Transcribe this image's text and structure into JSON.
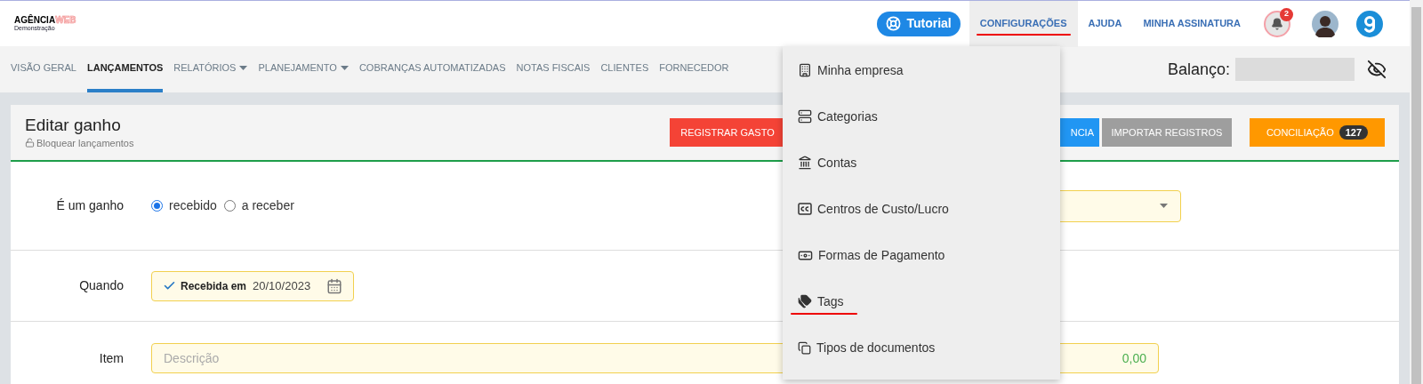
{
  "brand": {
    "name": "AGÊNCIA",
    "accent": "WEB",
    "subtitle": "Demonstração"
  },
  "top_nav": {
    "tutorial": "Tutorial",
    "notifications": "2",
    "links": [
      {
        "label": "CONFIGURAÇÕES",
        "selected": true,
        "highlighted": true
      },
      {
        "label": "AJUDA",
        "selected": false,
        "highlighted": false
      },
      {
        "label": "MINHA ASSINATURA",
        "selected": false,
        "highlighted": false
      }
    ]
  },
  "main_nav": [
    {
      "label": "VISÃO GERAL",
      "selected": false,
      "dropdown": false
    },
    {
      "label": "LANÇAMENTOS",
      "selected": true,
      "dropdown": false
    },
    {
      "label": "RELATÓRIOS",
      "selected": false,
      "dropdown": true
    },
    {
      "label": "PLANEJAMENTO",
      "selected": false,
      "dropdown": true
    },
    {
      "label": "COBRANÇAS AUTOMATIZADAS",
      "selected": false,
      "dropdown": false
    },
    {
      "label": "NOTAS FISCAIS",
      "selected": false,
      "dropdown": false
    },
    {
      "label": "CLIENTES",
      "selected": false,
      "dropdown": false
    },
    {
      "label": "FORNECEDOR",
      "selected": false,
      "dropdown": false
    }
  ],
  "balance": {
    "label": "Balanço:"
  },
  "page": {
    "title": "Editar ganho",
    "lock": "Bloquear lançamentos",
    "buttons": [
      {
        "label": "REGISTRAR GASTO",
        "kind": "danger"
      },
      {
        "label": "NCIA",
        "kind": "info"
      },
      {
        "label": "IMPORTAR REGISTROS",
        "kind": "neutral"
      },
      {
        "label": "CONCILIAÇÃO",
        "kind": "warning",
        "badge": "127"
      }
    ]
  },
  "form": {
    "gain": {
      "label": "É um ganho",
      "options": [
        {
          "label": "recebido",
          "selected": true
        },
        {
          "label": "a receber",
          "selected": false
        }
      ]
    },
    "when": {
      "label": "Quando",
      "status": "Recebida em",
      "date": "20/10/2023"
    },
    "item": {
      "label": "Item",
      "placeholder": "Descrição",
      "amount": "0,00"
    }
  },
  "menu": {
    "items": [
      {
        "label": "Minha empresa",
        "highlighted": false
      },
      {
        "label": "Categorias",
        "highlighted": false
      },
      {
        "label": "Contas",
        "highlighted": false
      },
      {
        "label": "Centros de Custo/Lucro",
        "highlighted": false
      },
      {
        "label": "Formas de Pagamento",
        "highlighted": false
      },
      {
        "label": "Tags",
        "highlighted": true
      },
      {
        "label": "Tipos de documentos",
        "highlighted": false
      }
    ]
  }
}
